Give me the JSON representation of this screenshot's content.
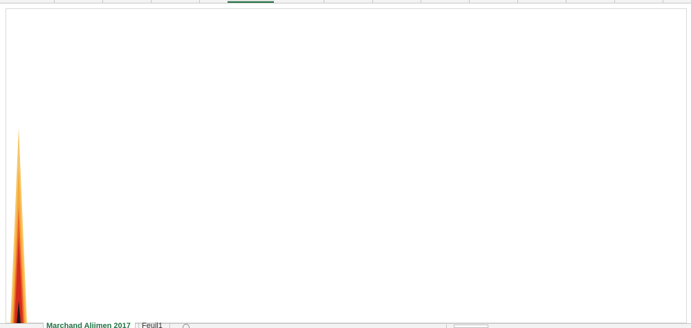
{
  "sheet_tabs": [
    {
      "label": "Marchand Aliimen 2017",
      "active": true
    },
    {
      "label": "Feuil1",
      "active": false
    }
  ],
  "icons": {
    "add_sheet": "plus-circle-icon"
  },
  "colors": {
    "accent_green": "#217346",
    "series_colors": [
      "#f6c667",
      "#f7a93a",
      "#e8602c",
      "#d42a1c",
      "#1a1a1a"
    ]
  },
  "chart_data": {
    "type": "area",
    "series": [
      {
        "values": [
          100
        ]
      },
      {
        "values": [
          80
        ]
      },
      {
        "values": [
          60
        ]
      },
      {
        "values": [
          45
        ]
      },
      {
        "values": [
          12
        ]
      }
    ]
  }
}
